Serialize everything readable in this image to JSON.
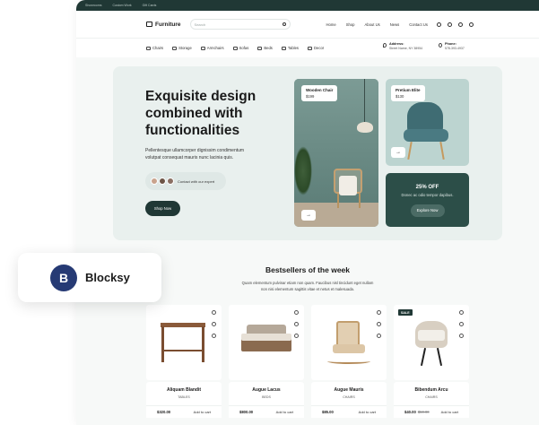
{
  "topbar": {
    "links": [
      "Showrooms",
      "Custom Work",
      "Gift Cards"
    ]
  },
  "header": {
    "logo": "Furniture",
    "search_placeholder": "Search",
    "nav": [
      "Home",
      "Shop",
      "About Us",
      "News",
      "Contact Us"
    ]
  },
  "categories": [
    "Chairs",
    "Storage",
    "Armchairs",
    "Sofas",
    "Beds",
    "Tables",
    "Decor"
  ],
  "contact": {
    "address_label": "Address:",
    "address_value": "Street Name, NY 38954",
    "phone_label": "Phone:",
    "phone_value": "578-393-4937"
  },
  "hero": {
    "title": "Exquisite design combined with functionalities",
    "description": "Pellentesque ullamcorper dignissim condimentum volutpat consequat mauris nunc lacinia quis.",
    "expert_label": "Contact with our expert",
    "cta": "Shop Now",
    "card_left": {
      "name": "Wooden Chair",
      "price": "$199"
    },
    "card_right": {
      "name": "Pretium Elite",
      "price": "$130"
    },
    "promo": {
      "title": "25% OFF",
      "subtitle": "Donec ac odio tempor dapibus.",
      "cta": "Explore Now"
    }
  },
  "bestsellers": {
    "title": "Bestsellers of the week",
    "description": "Quam elementum pulvinar etiam non quam. Faucibus nisl tincidunt eget nullam non nisi elementum sagittis vitae et netus et malesuada."
  },
  "products": [
    {
      "name": "Aliquam Blandit",
      "category": "TABLES",
      "price": "$320.00",
      "old_price": "",
      "cta": "Add to cart",
      "sale": ""
    },
    {
      "name": "Augue Lacus",
      "category": "BEDS",
      "price": "$800.00",
      "old_price": "",
      "cta": "Add to cart",
      "sale": ""
    },
    {
      "name": "Augue Mauris",
      "category": "CHAIRS",
      "price": "$85.00",
      "old_price": "",
      "cta": "Add to cart",
      "sale": ""
    },
    {
      "name": "Bibendum Arcu",
      "category": "CHAIRS",
      "price": "$40.00",
      "old_price": "$50.00",
      "cta": "Add to cart",
      "sale": "SALE"
    }
  ],
  "badge": {
    "logo_letter": "B",
    "name": "Blocksy"
  },
  "colors": {
    "primary": "#203835",
    "hero_bg": "#e9f0ee",
    "promo_bg": "#2c4e48",
    "badge_logo": "#263a74"
  }
}
